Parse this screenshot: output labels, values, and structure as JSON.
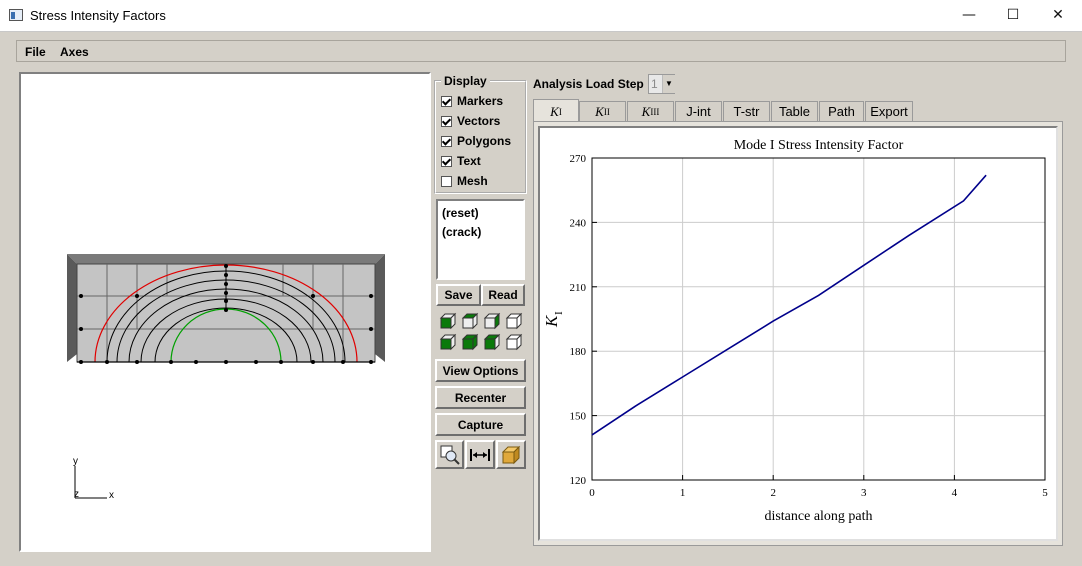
{
  "window": {
    "title": "Stress Intensity Factors",
    "minimize_glyph": "—",
    "maximize_glyph": "☐",
    "close_glyph": "✕"
  },
  "menu": [
    {
      "label": "File"
    },
    {
      "label": "Axes"
    }
  ],
  "viewport": {
    "axis_y": "y",
    "axis_z": "z",
    "axis_x": "x"
  },
  "display": {
    "title": "Display",
    "options": [
      {
        "label": "Markers",
        "checked": true
      },
      {
        "label": "Vectors",
        "checked": true
      },
      {
        "label": "Polygons",
        "checked": true
      },
      {
        "label": "Text",
        "checked": true
      },
      {
        "label": "Mesh",
        "checked": false
      }
    ]
  },
  "views_list": [
    "(reset)",
    "(crack)"
  ],
  "buttons": {
    "save": "Save",
    "read": "Read",
    "view_options": "View Options",
    "recenter": "Recenter",
    "capture": "Capture"
  },
  "view_icons": [
    "iso-view-icon",
    "front-view-icon",
    "side-view-icon",
    "wireframe-view-icon",
    "bottom-view-icon",
    "back-view-icon",
    "top-view-icon",
    "hidden-view-icon"
  ],
  "tool_icons": [
    "zoom-icon",
    "fit-width-icon",
    "shaded-cube-icon"
  ],
  "load_step": {
    "label": "Analysis Load Step",
    "value": "1"
  },
  "tabs": [
    {
      "main": "K",
      "sub": "I",
      "serif": true,
      "active": true
    },
    {
      "main": "K",
      "sub": "II",
      "serif": true
    },
    {
      "main": "K",
      "sub": "III",
      "serif": true
    },
    {
      "main": "J-int"
    },
    {
      "main": "T-str"
    },
    {
      "main": "Table"
    },
    {
      "main": "Path"
    },
    {
      "main": "Export"
    }
  ],
  "chart_data": {
    "type": "line",
    "title": "Mode I Stress Intensity Factor",
    "xlabel": "distance along path",
    "ylabel": "K",
    "ylabel_sub": "I",
    "xlim": [
      0,
      5
    ],
    "ylim": [
      120,
      270
    ],
    "xticks": [
      0,
      1,
      2,
      3,
      4,
      5
    ],
    "yticks": [
      120,
      150,
      180,
      210,
      240,
      270
    ],
    "grid": true,
    "line_color": "#00008b",
    "series": [
      {
        "x": [
          0,
          0.5,
          1.0,
          1.5,
          2.0,
          2.5,
          3.0,
          3.5,
          4.1,
          4.35
        ],
        "y": [
          141,
          155,
          168,
          181,
          194,
          206,
          220,
          234,
          250,
          262
        ]
      }
    ]
  },
  "colors": {
    "outer_contour": "#e00000",
    "inner_contour": "#00a000",
    "mesh_fill": "#c0c0c0",
    "frame_dark": "#5a5a5a"
  }
}
